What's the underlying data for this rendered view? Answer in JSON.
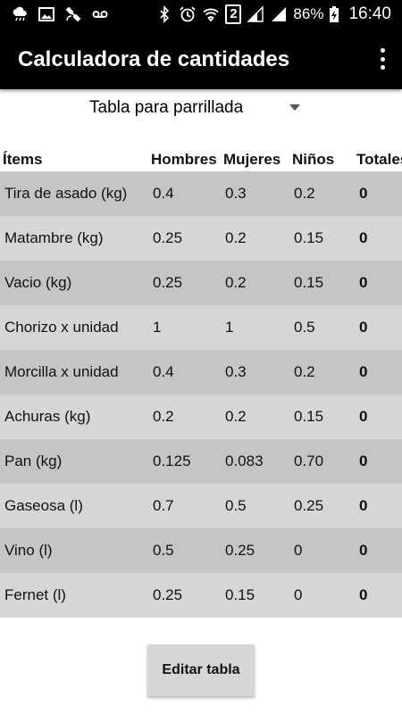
{
  "status_bar": {
    "battery_percent": "86%",
    "time": "16:40",
    "sim_badge": "2",
    "icons": [
      "weather-icon",
      "image-icon",
      "satellite-icon",
      "voicemail-icon",
      "bluetooth-icon",
      "alarm-icon",
      "wifi-icon",
      "sim-icon",
      "signal-icon",
      "signal-icon",
      "battery-charging-icon"
    ]
  },
  "app_bar": {
    "title": "Calculadora de cantidades",
    "menu_icon": "more-vert-icon"
  },
  "spinner": {
    "selected": "Tabla para parrillada"
  },
  "table": {
    "headers": {
      "item": "Ítems",
      "hombres": "Hombres",
      "mujeres": "Mujeres",
      "ninos": "Niños",
      "totales": "Totales"
    },
    "rows": [
      {
        "item": "Tira de asado (kg)",
        "hombres": "0.4",
        "mujeres": "0.3",
        "ninos": "0.2",
        "total": "0"
      },
      {
        "item": "Matambre (kg)",
        "hombres": "0.25",
        "mujeres": "0.2",
        "ninos": "0.15",
        "total": "0"
      },
      {
        "item": "Vacio (kg)",
        "hombres": "0.25",
        "mujeres": "0.2",
        "ninos": "0.15",
        "total": "0"
      },
      {
        "item": "Chorizo x unidad",
        "hombres": "1",
        "mujeres": "1",
        "ninos": "0.5",
        "total": "0"
      },
      {
        "item": "Morcilla x unidad",
        "hombres": "0.4",
        "mujeres": "0.3",
        "ninos": "0.2",
        "total": "0"
      },
      {
        "item": "Achuras (kg)",
        "hombres": "0.2",
        "mujeres": "0.2",
        "ninos": "0.15",
        "total": "0"
      },
      {
        "item": "Pan (kg)",
        "hombres": "0.125",
        "mujeres": "0.083",
        "ninos": "0.70",
        "total": "0"
      },
      {
        "item": "Gaseosa (l)",
        "hombres": "0.7",
        "mujeres": "0.5",
        "ninos": "0.25",
        "total": "0"
      },
      {
        "item": "Vino (l)",
        "hombres": "0.5",
        "mujeres": "0.25",
        "ninos": "0",
        "total": "0"
      },
      {
        "item": "Fernet (l)",
        "hombres": "0.25",
        "mujeres": "0.15",
        "ninos": "0",
        "total": "0"
      }
    ]
  },
  "edit_button": {
    "label": "Editar tabla"
  },
  "colors": {
    "app_bar": "#000000",
    "row_dark": "#c5c5c5",
    "row_light": "#d6d6d6",
    "button": "#d6d6d6"
  }
}
